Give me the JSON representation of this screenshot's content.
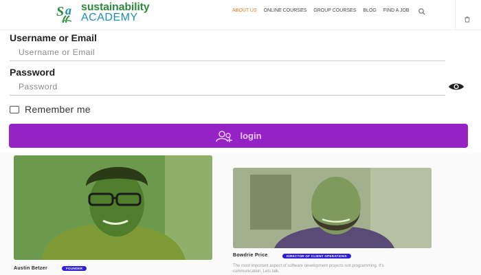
{
  "logo": {
    "line1": "sustainability",
    "line2": "ACADEMY"
  },
  "nav": {
    "items": [
      {
        "label": "ABOUT US",
        "active": true
      },
      {
        "label": "ONLINE COURSES",
        "active": false
      },
      {
        "label": "GROUP COURSES",
        "active": false
      },
      {
        "label": "BLOG",
        "active": false
      },
      {
        "label": "FIND A JOB",
        "active": false
      }
    ],
    "active_color": "#e2781d"
  },
  "icons": {
    "search": "search-icon",
    "cart": "cart-icon",
    "password_toggle": "eye-icon",
    "login": "users-icon"
  },
  "form": {
    "username_label": "Username or Email",
    "username_placeholder": "Username or Email",
    "password_label": "Password",
    "password_placeholder": "Password",
    "remember_label": "Remember me",
    "remember_checked": false,
    "login_label": "login",
    "login_color": "#9422c4"
  },
  "team": [
    {
      "name": "Austin Betzer",
      "role": "FOUNDER"
    },
    {
      "name": "Bowdrie Price",
      "role": "DIRECTOR OF CLIENT OPERATIONS",
      "bio": "The most important aspect of software development projects isnt programming. It's communication. Lets talk."
    }
  ],
  "badge_color": "#2f1fd8"
}
